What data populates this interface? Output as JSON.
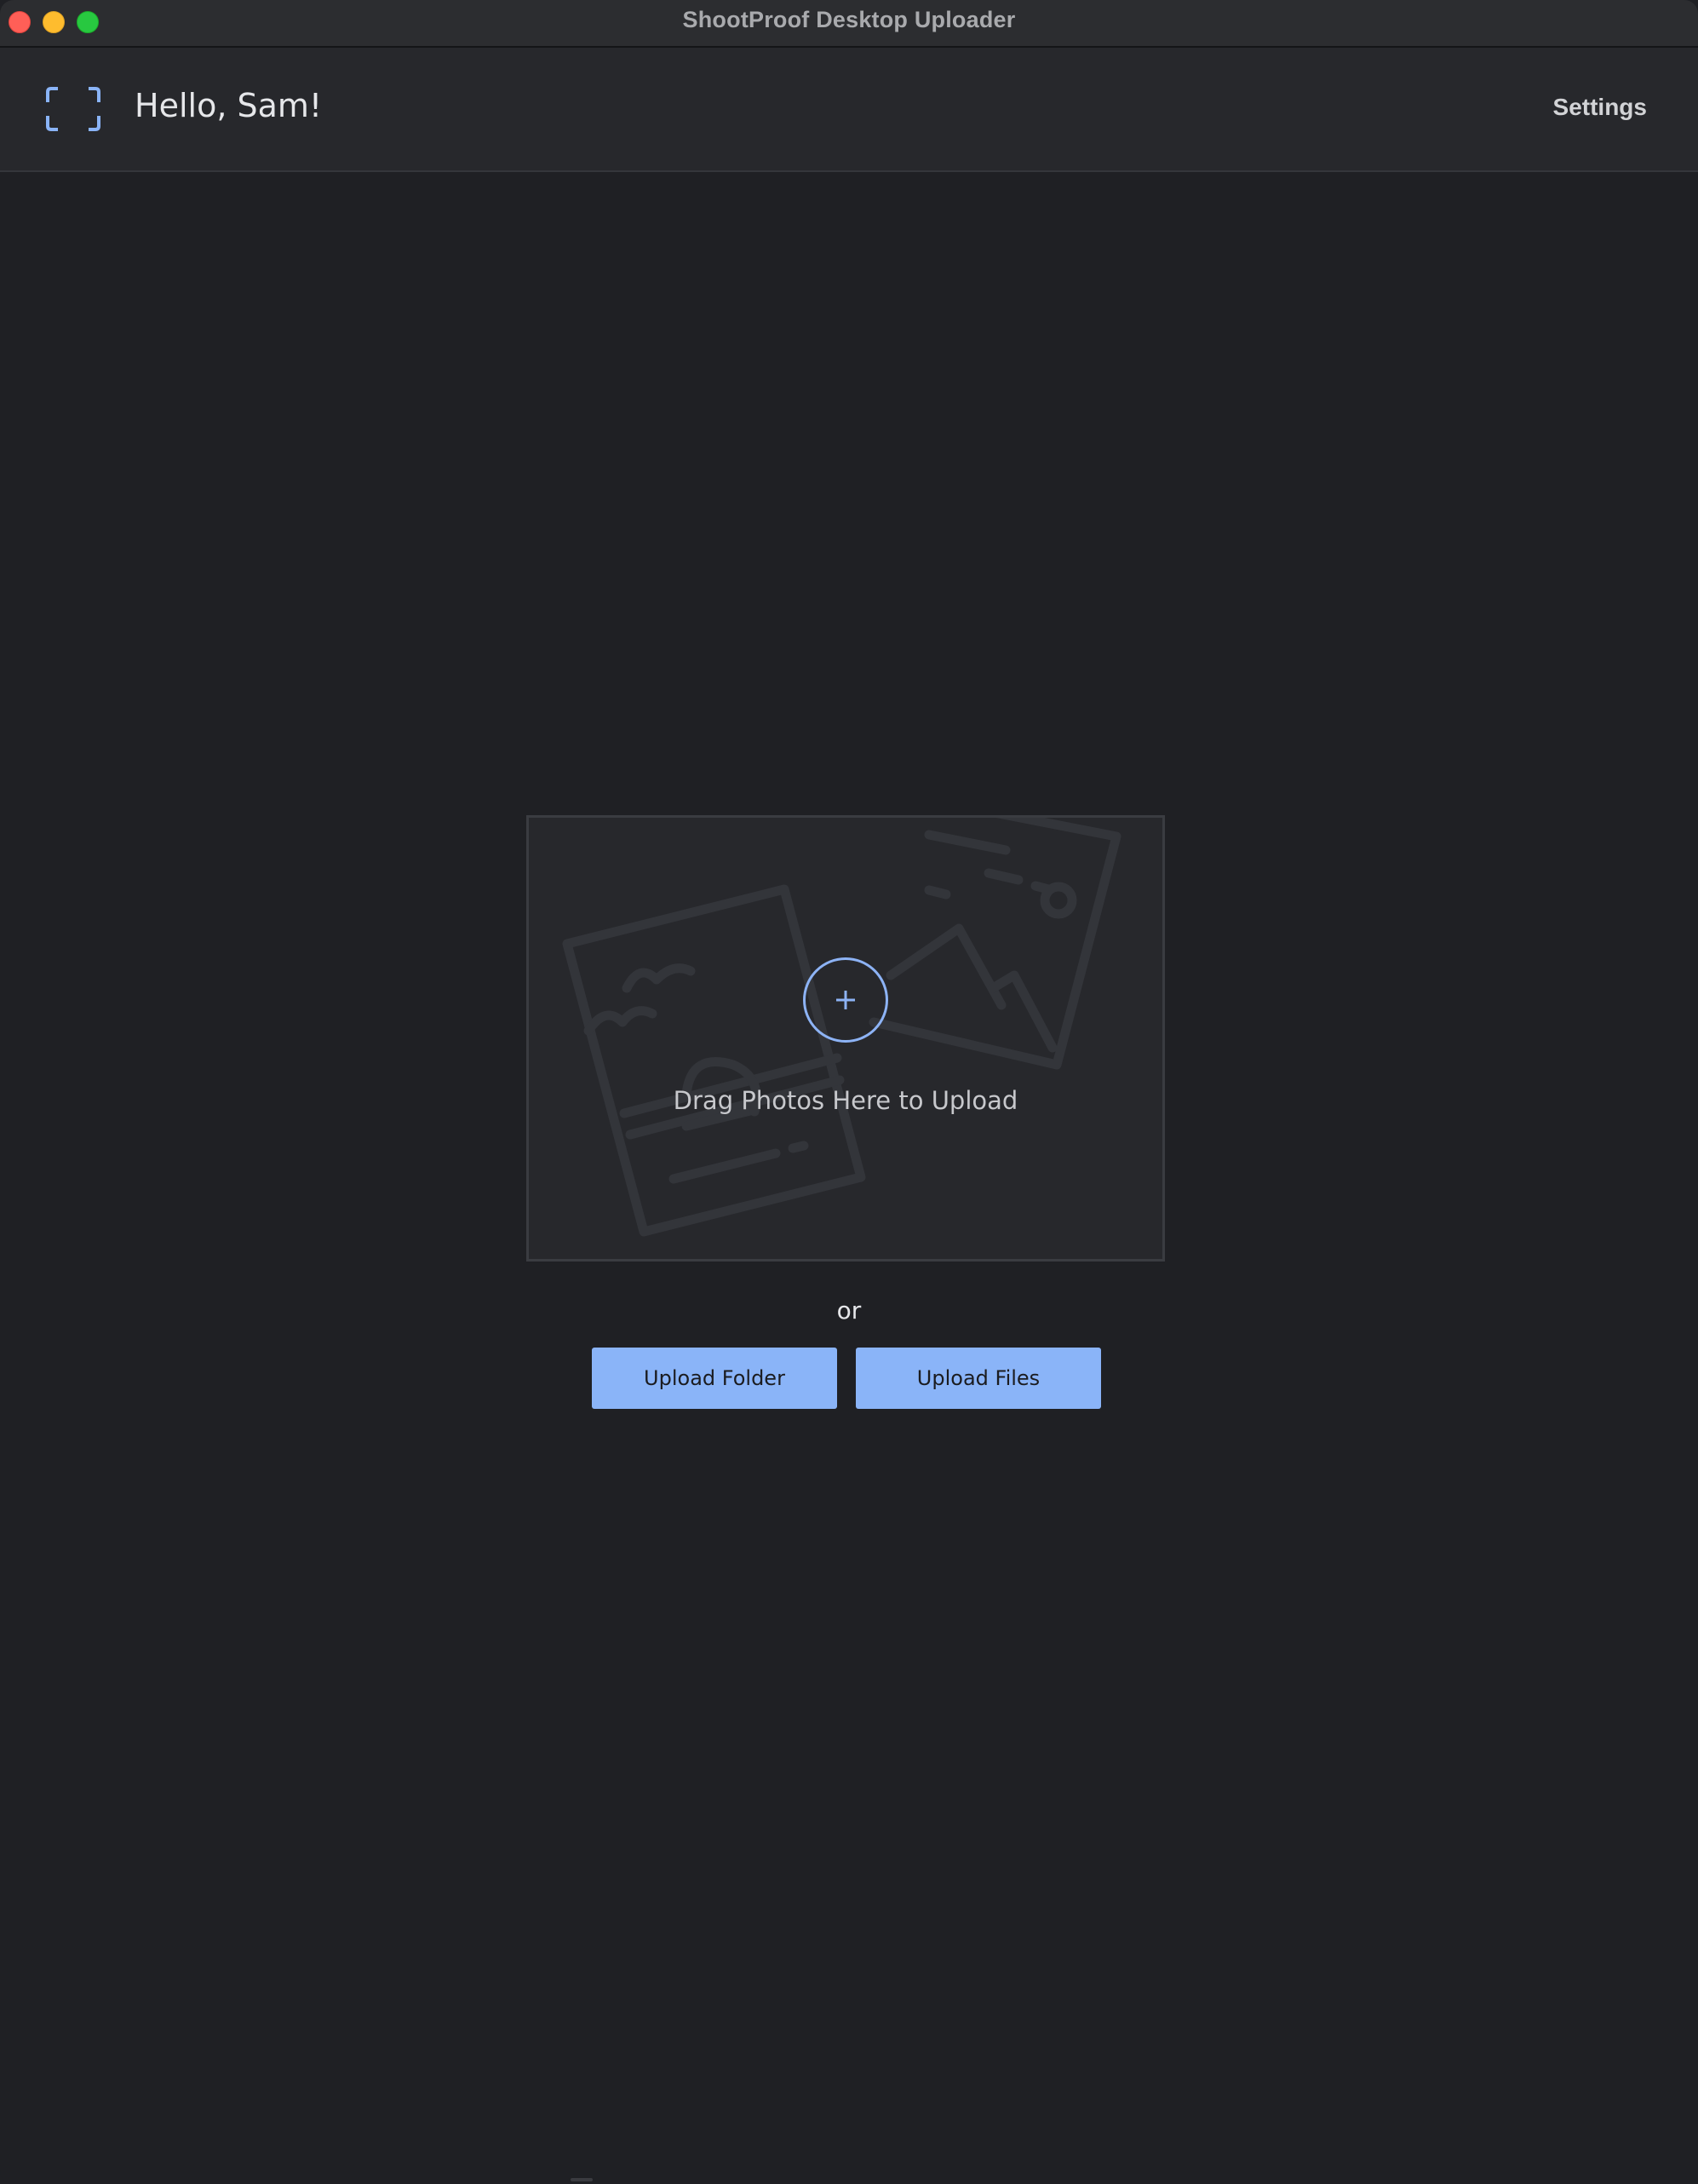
{
  "window": {
    "title": "ShootProof Desktop Uploader"
  },
  "header": {
    "greeting": "Hello, Sam!",
    "settings_label": "Settings",
    "logo_icon": "shootproof-frame-icon"
  },
  "dropzone": {
    "label": "Drag Photos Here to Upload",
    "add_icon": "plus-circle-icon"
  },
  "actions": {
    "or_label": "or",
    "upload_folder_label": "Upload Folder",
    "upload_files_label": "Upload Files"
  },
  "colors": {
    "accent": "#8ab4f8",
    "background": "#1f2024",
    "header_background": "#27282c"
  }
}
